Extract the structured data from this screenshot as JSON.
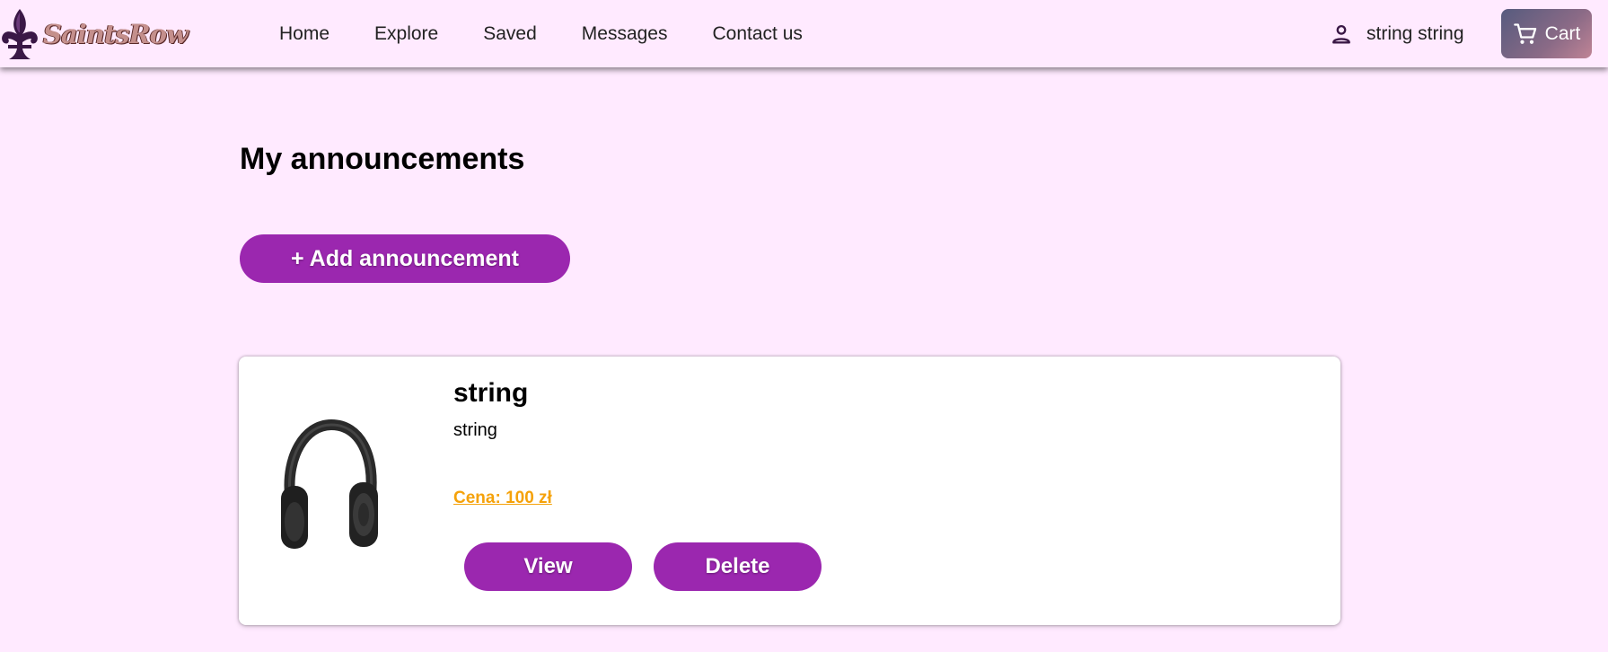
{
  "header": {
    "logo_text": "SaintsRow",
    "nav": [
      {
        "label": "Home"
      },
      {
        "label": "Explore"
      },
      {
        "label": "Saved"
      },
      {
        "label": "Messages"
      },
      {
        "label": "Contact us"
      }
    ],
    "user_name": "string string",
    "user_icon": "person-icon",
    "cart_label": "Cart",
    "cart_icon": "cart-icon"
  },
  "main": {
    "title": "My announcements",
    "add_button_label": "+ Add announcement",
    "announcements": [
      {
        "title": "string",
        "description": "string",
        "price": "Cena: 100 zł",
        "image": "headphones-image",
        "view_label": "View",
        "delete_label": "Delete"
      }
    ]
  },
  "colors": {
    "background": "#ffeaff",
    "primary_button": "#9b27af",
    "price": "#f5a20a",
    "card": "#ffffff"
  }
}
